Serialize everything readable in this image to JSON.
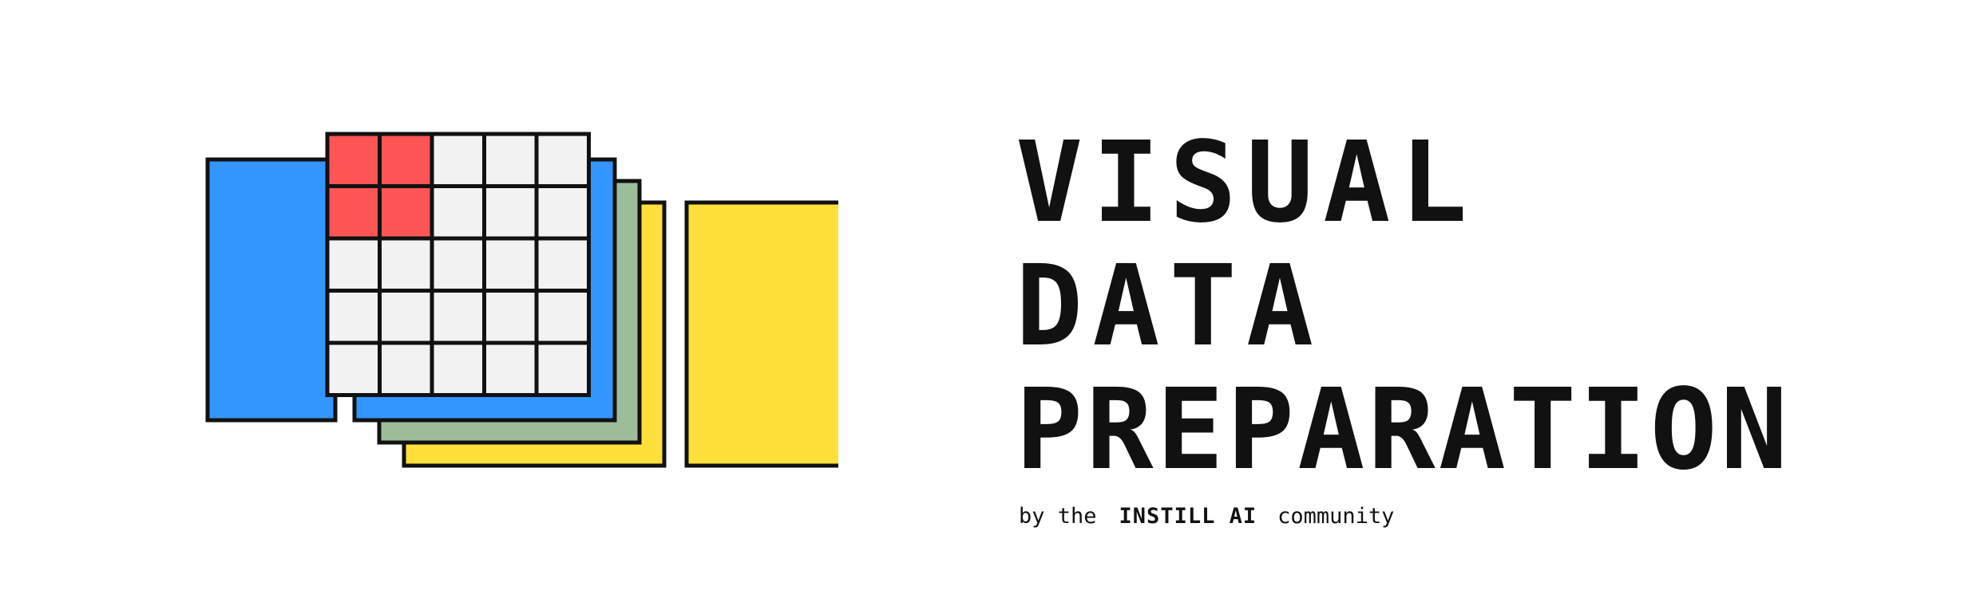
{
  "title_lines": [
    "VISUAL",
    "DATA",
    "PREPARATION"
  ],
  "byline": {
    "prefix": "by the",
    "brand": "INSTILL AI",
    "suffix": "community"
  },
  "colors": {
    "blue": "#3396FF",
    "green": "#9DBD9A",
    "yellow": "#FFDF3A",
    "red": "#FF5555",
    "cell": "#F2F2F2",
    "stroke": "#111111"
  },
  "illustration": {
    "name": "stacked-data-sheets",
    "grid_rows": 5,
    "grid_cols": 5,
    "highlighted_cells": [
      [
        0,
        0
      ],
      [
        0,
        1
      ],
      [
        1,
        0
      ],
      [
        1,
        1
      ]
    ]
  }
}
